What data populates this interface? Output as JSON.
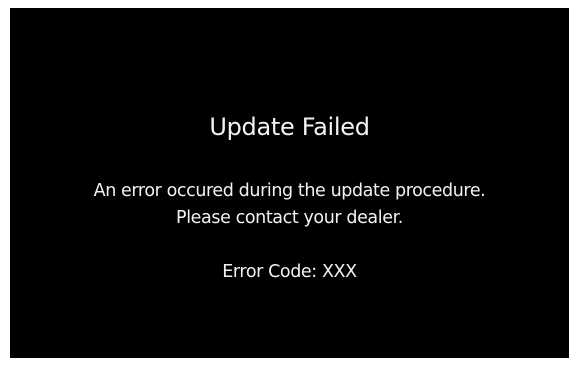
{
  "dialog": {
    "title": "Update Failed",
    "message_line1": "An error occured during the update procedure.",
    "message_line2": "Please contact your dealer.",
    "error_code": "Error Code: XXX"
  },
  "colors": {
    "screen_background": "#000000",
    "text": "#f2f2f2",
    "border": "#ffffff"
  }
}
